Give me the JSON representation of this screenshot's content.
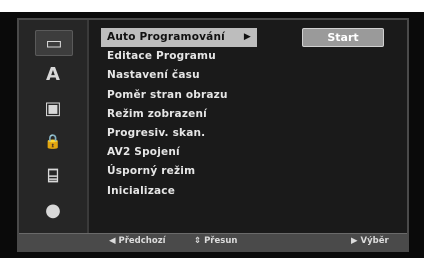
{
  "menu": {
    "items": [
      {
        "label": "Auto Programování",
        "selected": true
      },
      {
        "label": "Editace Programu"
      },
      {
        "label": "Nastavení času"
      },
      {
        "label": "Poměr stran obrazu"
      },
      {
        "label": "Režim zobrazení"
      },
      {
        "label": "Progresiv. skan."
      },
      {
        "label": "AV2 Spojení"
      },
      {
        "label": "Úsporný režim"
      },
      {
        "label": "Inicializace"
      }
    ],
    "selected_arrow": "▶"
  },
  "action": {
    "start_label": "Start"
  },
  "sidebar": {
    "icons": [
      {
        "name": "general-settings-icon",
        "glyph": "▭"
      },
      {
        "name": "language-icon",
        "glyph": "A"
      },
      {
        "name": "audio-icon",
        "glyph": "▣"
      },
      {
        "name": "lock-icon",
        "glyph": "🔒"
      },
      {
        "name": "recording-icon",
        "glyph": "⌸"
      },
      {
        "name": "disc-icon",
        "glyph": "●"
      }
    ]
  },
  "footer": {
    "back": "◀ Předchozí",
    "move": "⇕ Přesun",
    "select": "▶ Výběr"
  },
  "colors": {
    "selected_bg": "#bdbdbd",
    "osd_bg": "#1a1a1a",
    "footer_bg": "#4a4a4a"
  }
}
